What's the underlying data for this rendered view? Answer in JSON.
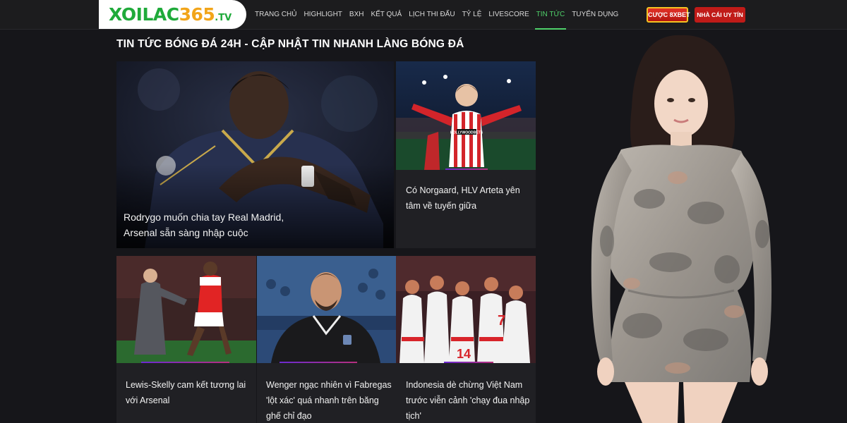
{
  "header": {
    "logo_main": "XOILAC",
    "logo_num": "365",
    "logo_tld": ".TV",
    "nav": [
      {
        "label": "TRANG CHỦ"
      },
      {
        "label": "HIGHLIGHT"
      },
      {
        "label": "BXH"
      },
      {
        "label": "KẾT QUẢ"
      },
      {
        "label": "LỊCH THI ĐẤU"
      },
      {
        "label": "TỶ LỆ"
      },
      {
        "label": "LIVESCORE"
      },
      {
        "label": "TIN TỨC",
        "active": true
      },
      {
        "label": "TUYỂN DỤNG"
      }
    ],
    "bet_button": "CƯỢC 8XBET",
    "trust_button": "NHÀ CÁI UY TÍN"
  },
  "page_title": "TIN TỨC BÓNG ĐÁ 24H - CẬP NHẬT TIN NHANH LÀNG BÓNG ĐÁ",
  "articles": {
    "featured": {
      "title": "Rodrygo muốn chia tay Real Madrid, Arsenal sẵn sàng nhập cuộc"
    },
    "a1": {
      "title": "Có Norgaard, HLV Arteta yên tâm về tuyến giữa"
    },
    "a2": {
      "title": "Lewis-Skelly cam kết tương lai với Arsenal"
    },
    "a3": {
      "title": "Wenger ngạc nhiên vì Fabregas 'lột xác' quá nhanh trên băng ghế chỉ đạo"
    },
    "a4": {
      "title": "Indonesia dè chừng Việt Nam trước viễn cảnh 'chạy đua nhập tịch'"
    }
  },
  "shirt_text": "HOLLYWOODBETS",
  "jersey_numbers": [
    "7",
    "14"
  ],
  "colors": {
    "accent": "#4fd16a",
    "background": "#16161a",
    "card": "#202024",
    "bet_red": "#c01b18",
    "gold": "#f5c321"
  }
}
